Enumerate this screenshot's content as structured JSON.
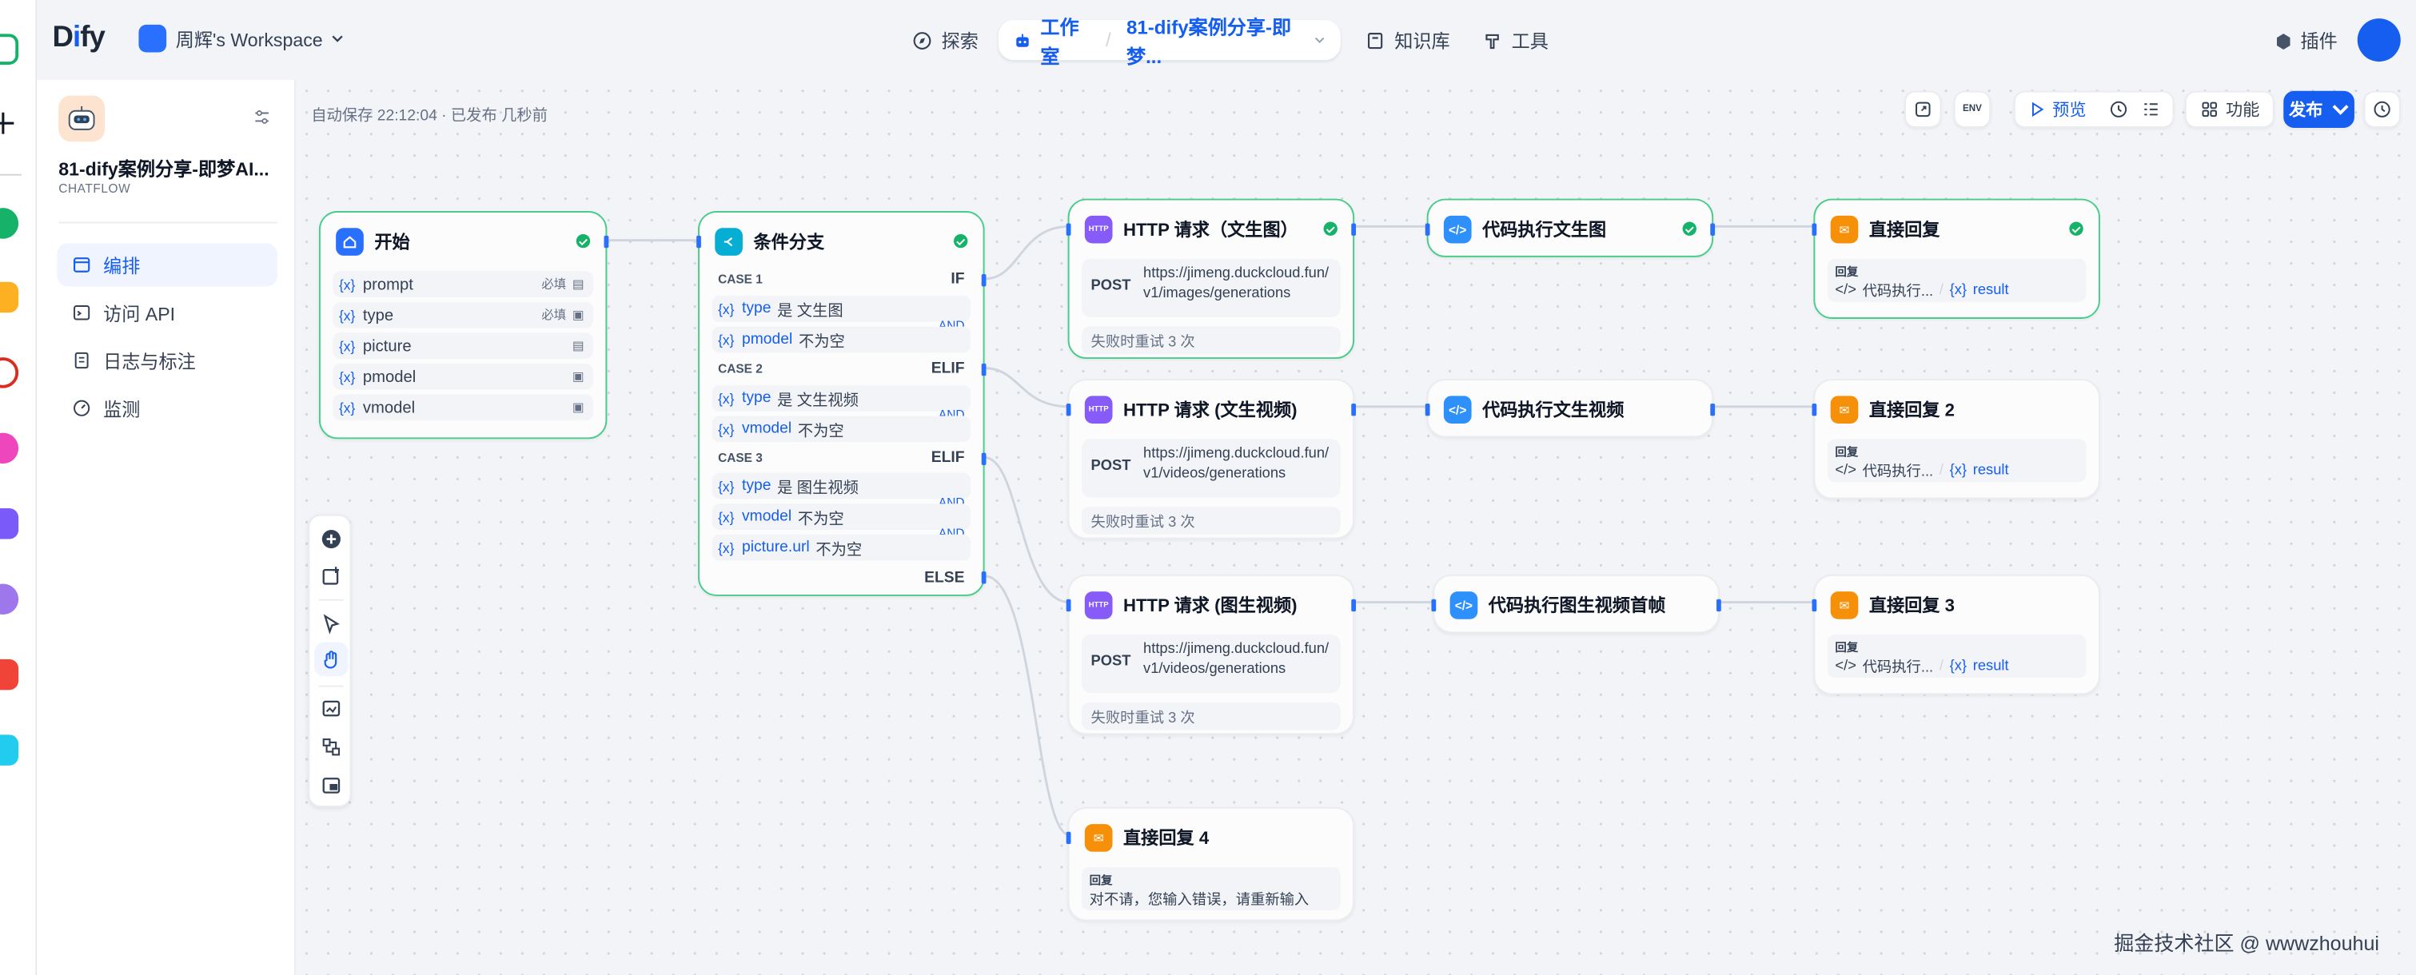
{
  "header": {
    "logo_prefix": "D",
    "logo_mid": "i",
    "logo_suffix": "fy",
    "workspace": "周辉's Workspace",
    "nav_explore": "探索",
    "nav_studio": "工作室",
    "nav_app": "81-dify案例分享-即梦...",
    "nav_knowledge": "知识库",
    "nav_tools": "工具",
    "plugins": "插件"
  },
  "sidebar": {
    "app_name": "81-dify案例分享-即梦AI...",
    "app_type": "CHATFLOW",
    "items": [
      {
        "label": "编排"
      },
      {
        "label": "访问 API"
      },
      {
        "label": "日志与标注"
      },
      {
        "label": "监测"
      }
    ]
  },
  "canvas": {
    "autosave": "自动保存 22:12:04 · 已发布 几秒前",
    "preview": "预览",
    "features": "功能",
    "publish": "发布",
    "env": "ENV"
  },
  "nodes": {
    "start": {
      "title": "开始",
      "vars": [
        {
          "name": "prompt",
          "tag": "必填"
        },
        {
          "name": "type",
          "tag": "必填"
        },
        {
          "name": "picture",
          "tag": ""
        },
        {
          "name": "pmodel",
          "tag": ""
        },
        {
          "name": "vmodel",
          "tag": ""
        }
      ]
    },
    "branch": {
      "title": "条件分支",
      "case1": "CASE 1",
      "if": "IF",
      "case2": "CASE 2",
      "elif1": "ELIF",
      "case3": "CASE 3",
      "elif2": "ELIF",
      "else": "ELSE",
      "and": "AND",
      "conds": [
        {
          "var": "type",
          "op": "是 文生图"
        },
        {
          "var": "pmodel",
          "op": "不为空"
        },
        {
          "var": "type",
          "op": "是 文生视频"
        },
        {
          "var": "vmodel",
          "op": "不为空"
        },
        {
          "var": "type",
          "op": "是 图生视频"
        },
        {
          "var": "vmodel",
          "op": "不为空"
        },
        {
          "var": "picture.url",
          "op": "不为空"
        }
      ]
    },
    "http1": {
      "title": "HTTP 请求（文生图）",
      "method": "POST",
      "url": "https://jimeng.duckcloud.fun/v1/images/generations",
      "retry": "失败时重试 3 次"
    },
    "http2": {
      "title": "HTTP 请求 (文生视频)",
      "method": "POST",
      "url": "https://jimeng.duckcloud.fun/v1/videos/generations",
      "retry": "失败时重试 3 次"
    },
    "http3": {
      "title": "HTTP 请求 (图生视频)",
      "method": "POST",
      "url": "https://jimeng.duckcloud.fun/v1/videos/generations",
      "retry": "失败时重试 3 次"
    },
    "code1": {
      "title": "代码执行文生图"
    },
    "code2": {
      "title": "代码执行文生视频"
    },
    "code3": {
      "title": "代码执行图生视频首帧"
    },
    "reply1": {
      "title": "直接回复",
      "label": "回复",
      "src": "代码执行...",
      "var": "result"
    },
    "reply2": {
      "title": "直接回复 2",
      "label": "回复",
      "src": "代码执行...",
      "var": "result"
    },
    "reply3": {
      "title": "直接回复 3",
      "label": "回复",
      "src": "代码执行...",
      "var": "result"
    },
    "reply4": {
      "title": "直接回复 4",
      "label": "回复",
      "text": "对不请，您输入错误，请重新输入"
    }
  },
  "watermark": "掘金技术社区 @ wwwzhouhui",
  "colors": {
    "accent": "#155eef",
    "success": "#17b26a",
    "http": "#875bf7",
    "code": "#2e90fa",
    "reply": "#f79009",
    "branch": "#06aed4",
    "start": "#2970ff"
  }
}
